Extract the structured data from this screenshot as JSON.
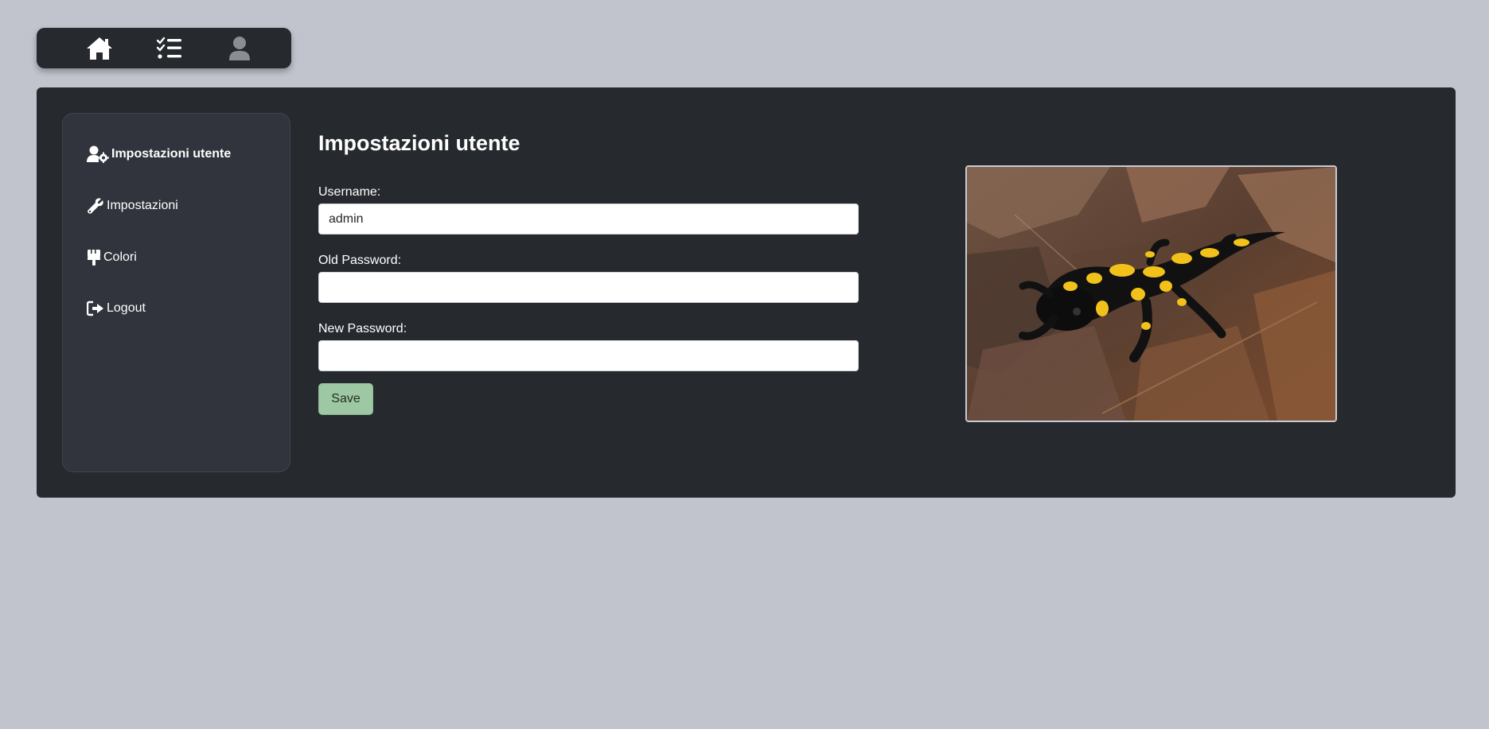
{
  "topnav": {
    "items": [
      {
        "name": "home",
        "icon": "home-icon",
        "color": "#ffffff"
      },
      {
        "name": "tasks",
        "icon": "task-list-icon",
        "color": "#ffffff"
      },
      {
        "name": "user",
        "icon": "user-icon",
        "color": "#8a8d94"
      }
    ]
  },
  "sidebar": {
    "items": [
      {
        "label": "Impostazioni utente",
        "icon": "user-gear-icon",
        "active": true
      },
      {
        "label": "Impostazioni",
        "icon": "wrench-icon",
        "active": false
      },
      {
        "label": "Colori",
        "icon": "paint-brush-icon",
        "active": false
      },
      {
        "label": "Logout",
        "icon": "logout-icon",
        "active": false
      }
    ]
  },
  "form": {
    "title": "Impostazioni utente",
    "username_label": "Username:",
    "username_value": "admin",
    "old_password_label": "Old Password:",
    "old_password_value": "",
    "new_password_label": "New Password:",
    "new_password_value": "",
    "save_label": "Save"
  },
  "image": {
    "subject": "fire salamander on dead leaves",
    "icon": "salamander-photo"
  },
  "colors": {
    "page_bg": "#c1c4cd",
    "panel_bg": "#26292e",
    "sidebar_bg": "#31343c",
    "save_button": "#9ec8a3"
  }
}
